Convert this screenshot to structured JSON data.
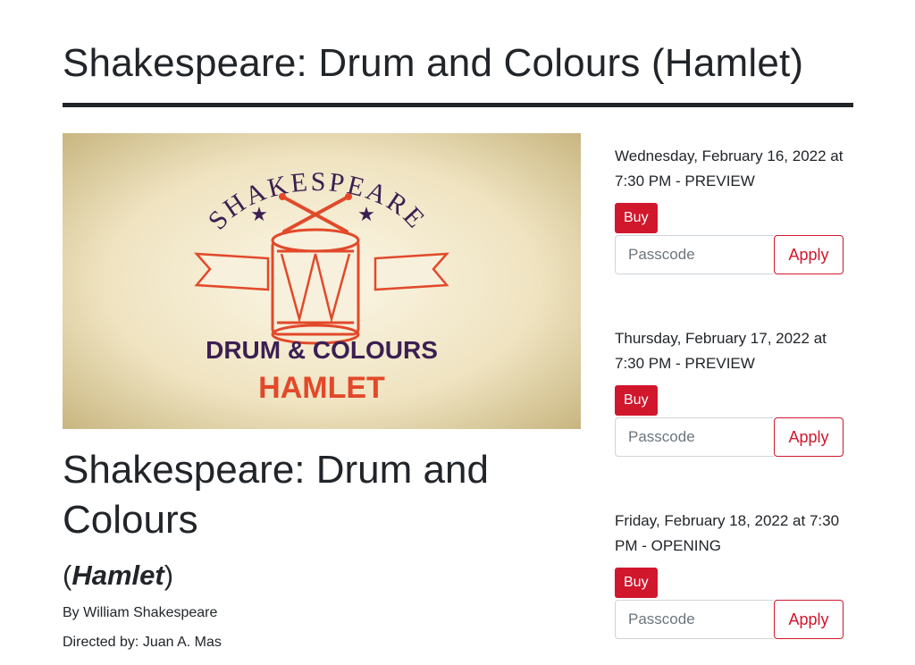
{
  "header": {
    "title": "Shakespeare: Drum and Colours (Hamlet)"
  },
  "poster": {
    "arc_text": "SHAKESPEARE",
    "line1": "DRUM & COLOURS",
    "line2": "HAMLET",
    "colors": {
      "purple": "#3b1f52",
      "orange": "#e2492a",
      "bg": "#e9dcb6"
    }
  },
  "show": {
    "title": "Shakespeare: Drum and Colours",
    "subtitle_open": "(",
    "subtitle_play": "Hamlet",
    "subtitle_close": ")",
    "author": "By William Shakespeare",
    "director": "Directed by: Juan A. Mas"
  },
  "performances": [
    {
      "date": "Wednesday, February 16, 2022 at 7:30 PM - PREVIEW",
      "buy_label": "Buy",
      "passcode_placeholder": "Passcode",
      "apply_label": "Apply"
    },
    {
      "date": "Thursday, February 17, 2022 at 7:30 PM - PREVIEW",
      "buy_label": "Buy",
      "passcode_placeholder": "Passcode",
      "apply_label": "Apply"
    },
    {
      "date": "Friday, February 18, 2022 at 7:30 PM - OPENING",
      "buy_label": "Buy",
      "passcode_placeholder": "Passcode",
      "apply_label": "Apply"
    }
  ],
  "colors": {
    "accent": "#d0172c",
    "text": "#212529"
  }
}
